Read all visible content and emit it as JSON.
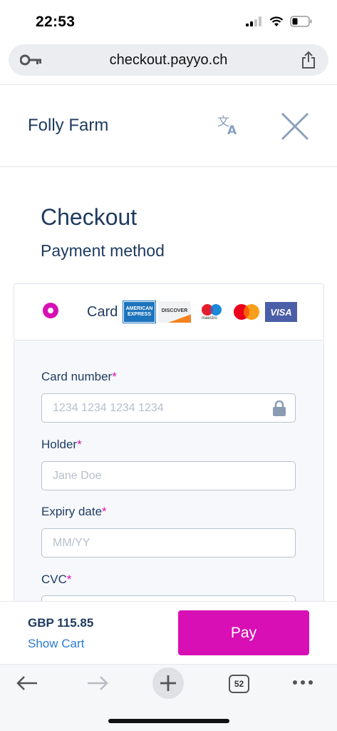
{
  "status_bar": {
    "time": "22:53",
    "icons": [
      "signal-icon",
      "wifi-icon",
      "battery-icon"
    ]
  },
  "browser": {
    "url": "checkout.payyo.ch",
    "tab_count": "52",
    "icons": [
      "key-icon",
      "share-icon",
      "back-icon",
      "forward-icon",
      "new-tab-icon",
      "more-icon"
    ]
  },
  "merchant": {
    "name": "Folly Farm"
  },
  "checkout": {
    "title": "Checkout",
    "payment_method_title": "Payment method",
    "option_label": "Card",
    "card_logos": {
      "amex": "AMERICAN EXPRESS",
      "discover": "DISCOVER",
      "maestro": "maestro",
      "visa": "VISA"
    }
  },
  "form": {
    "required_mark": "*",
    "card_number": {
      "label": "Card number",
      "placeholder": "1234 1234 1234 1234"
    },
    "holder": {
      "label": "Holder",
      "placeholder": "Jane Doe"
    },
    "expiry": {
      "label": "Expiry date",
      "placeholder": "MM/YY"
    },
    "cvc": {
      "label": "CVC"
    }
  },
  "footer": {
    "total": "GBP 115.85",
    "show_cart": "Show Cart",
    "pay_label": "Pay"
  },
  "colors": {
    "accent": "#d70fb4",
    "heading": "#1e3a5f",
    "link": "#2a7bd0"
  }
}
